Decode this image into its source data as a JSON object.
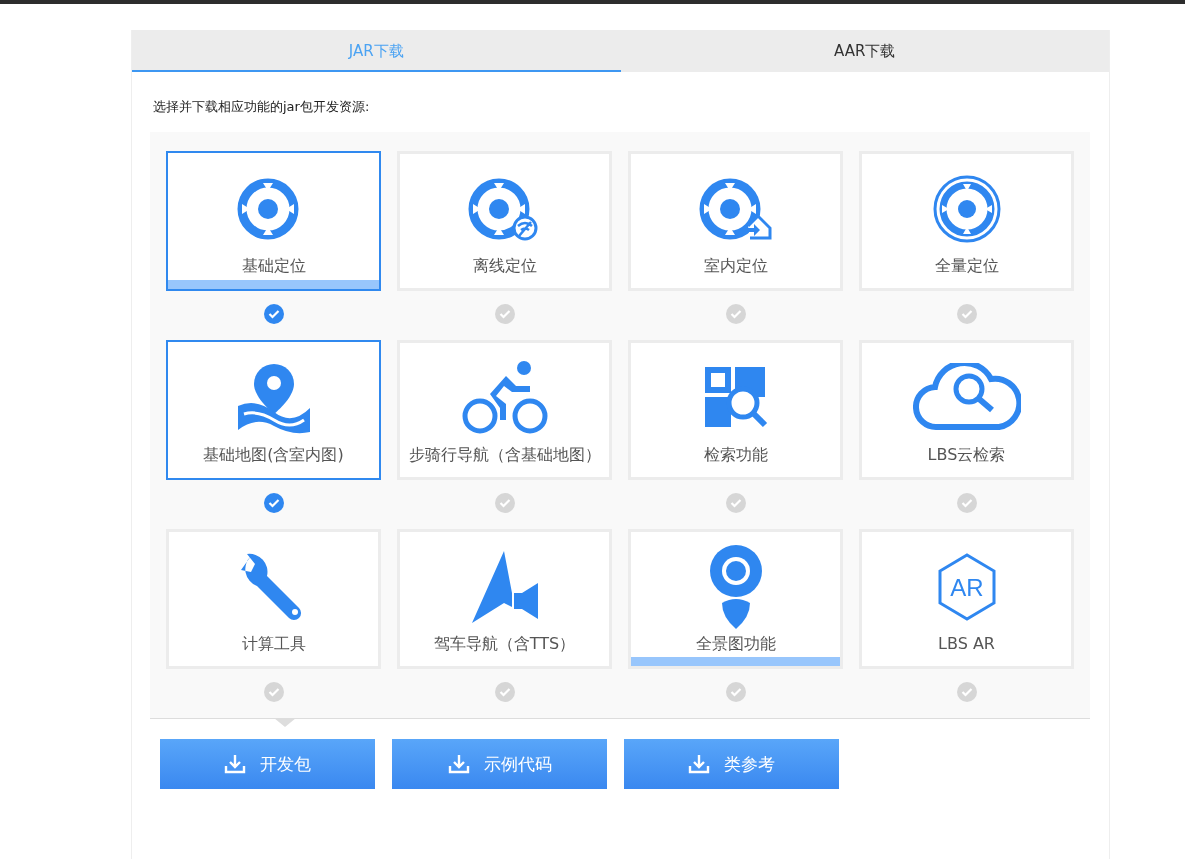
{
  "tabs": [
    {
      "label": "JAR下载",
      "selected": true
    },
    {
      "label": "AAR下载",
      "selected": false
    }
  ],
  "instruction": "选择并下载相应功能的jar包开发资源:",
  "cards": [
    {
      "kind": "target",
      "label": "基础定位",
      "checked": true,
      "highlighted": true
    },
    {
      "kind": "offline",
      "label": "离线定位",
      "checked": false,
      "highlighted": false
    },
    {
      "kind": "indoor",
      "label": "室内定位",
      "checked": false,
      "highlighted": false
    },
    {
      "kind": "full",
      "label": "全量定位",
      "checked": false,
      "highlighted": false
    },
    {
      "kind": "pin",
      "label": "基础地图(含室内图)",
      "checked": true,
      "highlighted": false
    },
    {
      "kind": "cyclist",
      "label": "步骑行导航（含基础地图）",
      "checked": false,
      "highlighted": false
    },
    {
      "kind": "search",
      "label": "检索功能",
      "checked": false,
      "highlighted": false
    },
    {
      "kind": "cloud",
      "label": "LBS云检索",
      "checked": false,
      "highlighted": false
    },
    {
      "kind": "wrench",
      "label": "计算工具",
      "checked": false,
      "highlighted": false
    },
    {
      "kind": "nav",
      "label": "驾车导航（含TTS）",
      "checked": false,
      "highlighted": false
    },
    {
      "kind": "panorama",
      "label": "全景图功能",
      "checked": false,
      "highlighted": true
    },
    {
      "kind": "ar",
      "icon_text": "AR",
      "label": "LBS AR",
      "checked": false,
      "highlighted": false
    }
  ],
  "buttons": [
    "开发包",
    "示例代码",
    "类参考"
  ]
}
